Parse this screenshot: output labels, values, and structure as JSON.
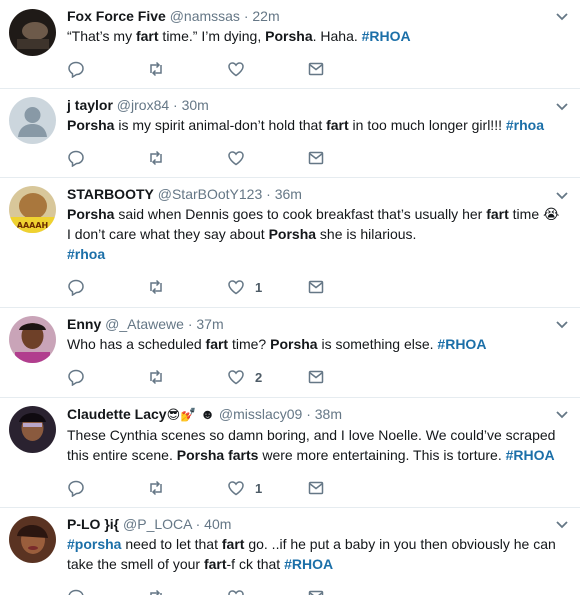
{
  "tweets": [
    {
      "name": "Fox Force Five",
      "handle": "@namssas",
      "sep": "·",
      "time": "22m",
      "avatar_icon": "avatar-dark-photo",
      "parts": [
        [
          "t",
          "“That’s my "
        ],
        [
          "b",
          "fart"
        ],
        [
          "t",
          " time.” I’m dying, "
        ],
        [
          "b",
          "Porsha"
        ],
        [
          "t",
          ". Haha. "
        ],
        [
          "h",
          "#RHOA"
        ]
      ],
      "likes": ""
    },
    {
      "name": "j taylor",
      "handle": "@jrox84",
      "sep": "·",
      "time": "30m",
      "avatar_icon": "default-egg-avatar",
      "parts": [
        [
          "b",
          "Porsha"
        ],
        [
          "t",
          " is my spirit animal-don’t hold that "
        ],
        [
          "b",
          "fart"
        ],
        [
          "t",
          " in too much longer girl!!! "
        ],
        [
          "h",
          "#rhoa"
        ]
      ],
      "likes": ""
    },
    {
      "name": "STARBOOTY",
      "handle": "@StarBOotY123",
      "sep": "·",
      "time": "36m",
      "avatar_icon": "avatar-meme-photo",
      "parts": [
        [
          "b",
          "Porsha"
        ],
        [
          "t",
          " said when Dennis goes to cook breakfast that’s usually her "
        ],
        [
          "b",
          "fart"
        ],
        [
          "t",
          " time 😭"
        ],
        [
          "br",
          ""
        ],
        [
          "t",
          "I don’t care what they say about "
        ],
        [
          "b",
          "Porsha"
        ],
        [
          "t",
          " she is hilarious."
        ],
        [
          "br",
          ""
        ],
        [
          "h",
          "#rhoa"
        ]
      ],
      "likes": "1"
    },
    {
      "name": "Enny",
      "handle": "@_Atawewe",
      "sep": "·",
      "time": "37m",
      "avatar_icon": "avatar-woman-photo",
      "parts": [
        [
          "t",
          "Who has a scheduled "
        ],
        [
          "b",
          "fart"
        ],
        [
          "t",
          " time? "
        ],
        [
          "b",
          "Porsha"
        ],
        [
          "t",
          " is something else.  "
        ],
        [
          "h",
          "#RHOA"
        ]
      ],
      "likes": "2"
    },
    {
      "name": "Claudette Lacy",
      "name_emoji": "😎💅",
      "name_symbol": "☻",
      "handle": "@misslacy09",
      "sep": "·",
      "time": "38m",
      "avatar_icon": "avatar-woman-photo",
      "parts": [
        [
          "t",
          "These Cynthia scenes so damn boring, and I love Noelle. We could’ve scraped this entire scene. "
        ],
        [
          "b",
          "Porsha farts"
        ],
        [
          "t",
          " were more entertaining. This is torture. "
        ],
        [
          "h",
          "#RHOA"
        ]
      ],
      "likes": "1"
    },
    {
      "name": "P-LO }i{",
      "handle": "@P_LOCA",
      "sep": "·",
      "time": "40m",
      "avatar_icon": "avatar-woman-photo",
      "parts": [
        [
          "h",
          "#porsha"
        ],
        [
          "t",
          " need to let that "
        ],
        [
          "b",
          "fart"
        ],
        [
          "t",
          " go. ..if he put a baby in you then obviously he can take the smell of your "
        ],
        [
          "b",
          "fart"
        ],
        [
          "t",
          "-f  ck that "
        ],
        [
          "h",
          "#RHOA"
        ]
      ],
      "likes": ""
    }
  ],
  "colors": {
    "link": "#1b6fa8",
    "meta": "#657786",
    "divider": "#e6ecf0"
  }
}
